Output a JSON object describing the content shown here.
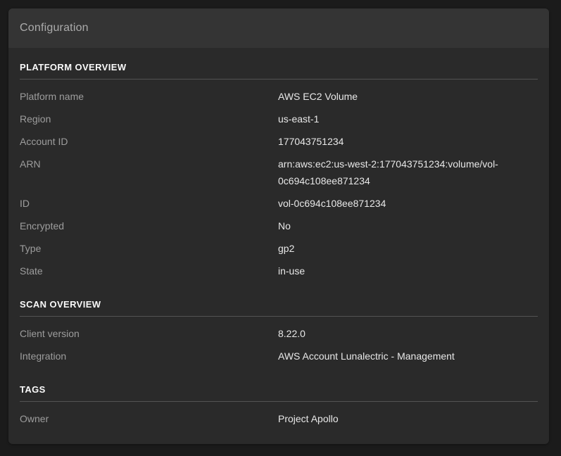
{
  "panel": {
    "title": "Configuration"
  },
  "colors": {
    "page_background": "#1b1b1b",
    "card_background": "#2a2a2a",
    "header_background": "#343434",
    "header_text": "#ababab",
    "section_title_text": "#fafafa",
    "label_text": "#9d9d9d",
    "value_text": "#e8e8e8",
    "divider": "#535353"
  },
  "sections": [
    {
      "title": "PLATFORM OVERVIEW",
      "rows": [
        {
          "label": "Platform name",
          "value": "AWS EC2 Volume"
        },
        {
          "label": "Region",
          "value": "us-east-1"
        },
        {
          "label": "Account ID",
          "value": "177043751234"
        },
        {
          "label": "ARN",
          "value": "arn:aws:ec2:us-west-2:177043751234:volume/vol-0c694c108ee871234"
        },
        {
          "label": "ID",
          "value": "vol-0c694c108ee871234"
        },
        {
          "label": "Encrypted",
          "value": "No"
        },
        {
          "label": "Type",
          "value": "gp2"
        },
        {
          "label": "State",
          "value": "in-use"
        }
      ]
    },
    {
      "title": "SCAN OVERVIEW",
      "rows": [
        {
          "label": "Client version",
          "value": "8.22.0"
        },
        {
          "label": "Integration",
          "value": "AWS Account Lunalectric - Management"
        }
      ]
    },
    {
      "title": "TAGS",
      "rows": [
        {
          "label": "Owner",
          "value": "Project Apollo"
        }
      ]
    }
  ]
}
